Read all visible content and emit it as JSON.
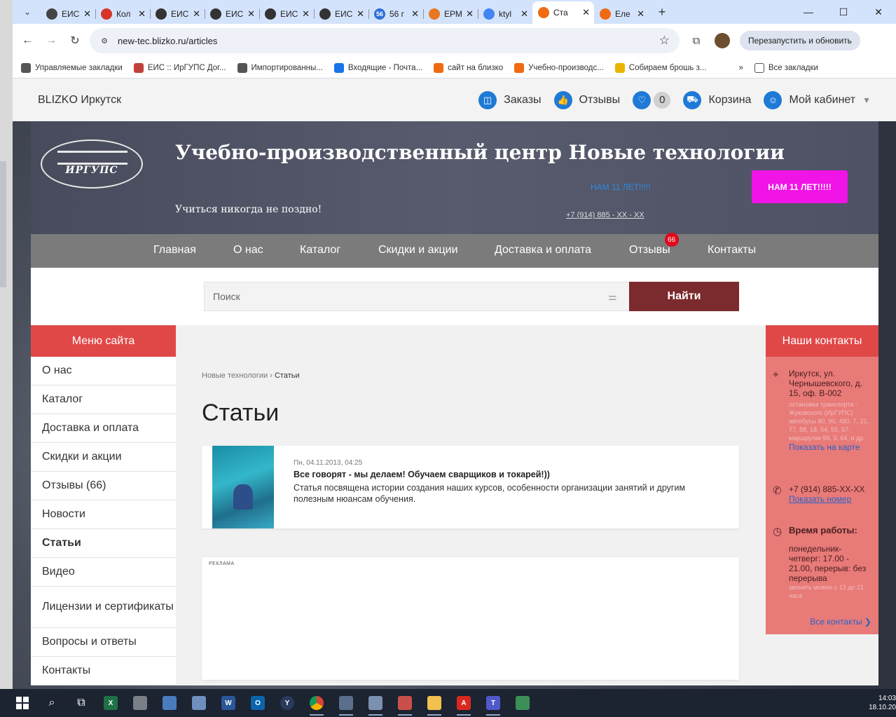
{
  "browser": {
    "tabs": [
      {
        "title": "ЕИС",
        "icon": "user-icon",
        "color": "#444"
      },
      {
        "title": "Кол",
        "icon": "flag-icon",
        "color": "#d6342b"
      },
      {
        "title": "ЕИС",
        "icon": "globe-icon",
        "color": "#333"
      },
      {
        "title": "ЕИС",
        "icon": "globe-icon",
        "color": "#333"
      },
      {
        "title": "ЕИС",
        "icon": "globe-icon",
        "color": "#333"
      },
      {
        "title": "ЕИС",
        "icon": "globe-icon",
        "color": "#333"
      },
      {
        "title": "56 г",
        "icon": "counter-icon",
        "color": "#2d6fd6",
        "badge": "56"
      },
      {
        "title": "ЕРМ",
        "icon": "grid-icon",
        "color": "#e8781f"
      },
      {
        "title": "ktyl",
        "icon": "google-icon",
        "color": "#4285f4"
      },
      {
        "title": "Ста",
        "icon": "blizko-icon",
        "color": "#f06a12",
        "active": true
      },
      {
        "title": "Еле",
        "icon": "blizko-icon",
        "color": "#f06a12"
      }
    ],
    "new_tab": "+",
    "url": "new-tec.blizko.ru/articles",
    "restart_label": "Перезапустить и обновить",
    "bookmarks": [
      {
        "label": "Управляемые закладки",
        "color": "#555"
      },
      {
        "label": "ЕИС :: ИрГУПС Дог...",
        "color": "#c2403a"
      },
      {
        "label": "Импортированны...",
        "color": "#555"
      },
      {
        "label": "Входящие - Почта...",
        "color": "#1a73e8"
      },
      {
        "label": "сайт на близко",
        "color": "#f06a12"
      },
      {
        "label": "Учебно-производс...",
        "color": "#f06a12"
      },
      {
        "label": "Собираем брошь з...",
        "color": "#e8b400"
      }
    ],
    "bookmarks_more": "»",
    "all_bookmarks": "Все закладки"
  },
  "site": {
    "brand": "BLIZKO Иркутск",
    "topnav": {
      "orders": "Заказы",
      "reviews": "Отзывы",
      "favorites_count": "0",
      "cart": "Корзина",
      "cabinet": "Мой кабинет"
    },
    "banner": {
      "logo_text": "ИРГУПС",
      "title": "Учебно-производственный центр Новые технологии",
      "slogan": "Учиться никогда не поздно!",
      "anniv_link": "НАМ 11 ЛЕТ!!!!!",
      "phone": "+7 (914) 885 - XX - XX",
      "anniv_button": "НАМ 11 ЛЕТ!!!!!"
    },
    "mainnav": [
      {
        "label": "Главная"
      },
      {
        "label": "О нас"
      },
      {
        "label": "Каталог"
      },
      {
        "label": "Скидки и акции"
      },
      {
        "label": "Доставка и оплата"
      },
      {
        "label": "Отзывы",
        "badge": "66"
      },
      {
        "label": "Контакты"
      }
    ],
    "search": {
      "placeholder": "Поиск",
      "button": "Найти"
    },
    "side_menu": {
      "title": "Меню сайта",
      "items": [
        {
          "label": "О нас"
        },
        {
          "label": "Каталог"
        },
        {
          "label": "Доставка и оплата"
        },
        {
          "label": "Скидки и акции"
        },
        {
          "label": "Отзывы (66)"
        },
        {
          "label": "Новости"
        },
        {
          "label": "Статьи",
          "active": true
        },
        {
          "label": "Видео"
        },
        {
          "label": "Лицензии и сертификаты",
          "tall": true
        },
        {
          "label": "Вопросы и ответы"
        },
        {
          "label": "Контакты"
        }
      ]
    },
    "breadcrumb": {
      "root": "Новые технологии",
      "sep": "›",
      "current": "Статьи"
    },
    "page_title": "Статьи",
    "article": {
      "date": "Пн, 04.11.2013, 04:25",
      "title": "Все говорят - мы делаем! Обучаем сварщиков и токарей!))",
      "desc": "Статья посвящена истории создания наших курсов, особенности организации занятий и другим полезным нюансам обучения."
    },
    "ad_label": "РЕКЛАМА",
    "contacts": {
      "title": "Наши контакты",
      "address": "Иркутск, ул. Чернышевского, д. 15, оф. В-002",
      "transport": "остановка транспорта - Жуковского (ИрГУПС) автобусы 80, 90, 480, 7, 21, 77, 88, 18, 54, 55, 57, маршрутки 99, 3, 64, и др.",
      "show_map": "Показать на карте",
      "phone": "+7 (914) 885-XX-XX",
      "show_number": "Показать номер",
      "hours_title": "Время работы:",
      "hours": "понедельник-четверг: 17.00 - 21.00, перерыв: без перерыва",
      "hours_note": "звонить можно с 13 до 21 часа",
      "all_contacts": "Все контакты ❯"
    }
  },
  "taskbar": {
    "time": "14:03",
    "date": "18.10.20"
  }
}
